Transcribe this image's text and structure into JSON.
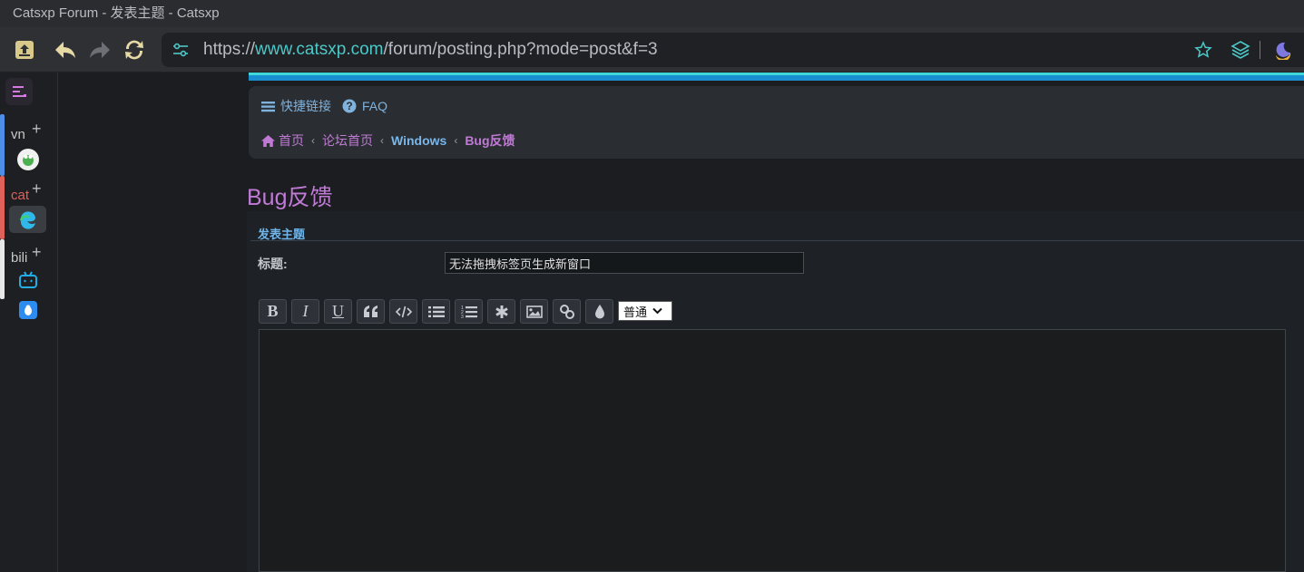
{
  "window": {
    "title": "Catsxp Forum - 发表主题 - Catsxp"
  },
  "toolbar": {
    "url_scheme": "https://",
    "url_host": "www.catsxp.com",
    "url_path": "/forum/posting.php?mode=post&f=3"
  },
  "sidebar": {
    "groups": [
      {
        "label": "vn",
        "color": "#4d8fe8",
        "plus": "+"
      },
      {
        "label": "cat",
        "color": "#e0605a",
        "plus": "+"
      },
      {
        "label": "bili",
        "color": "#e8e8e8",
        "plus": "+"
      }
    ]
  },
  "nav": {
    "quicklinks": "快捷链接",
    "faq": "FAQ",
    "breadcrumbs": [
      "首页",
      "论坛首页",
      "Windows",
      "Bug反馈"
    ]
  },
  "page": {
    "title": "Bug反馈",
    "panel_heading": "发表主题",
    "subject_label": "标题:",
    "subject_value": "无法拖拽标签页生成新窗口",
    "font_size_select": "普通"
  },
  "colors": {
    "accent_teal": "#3ed8d8",
    "link_blue": "#79b6ea",
    "forum_purple": "#c07ad6"
  }
}
